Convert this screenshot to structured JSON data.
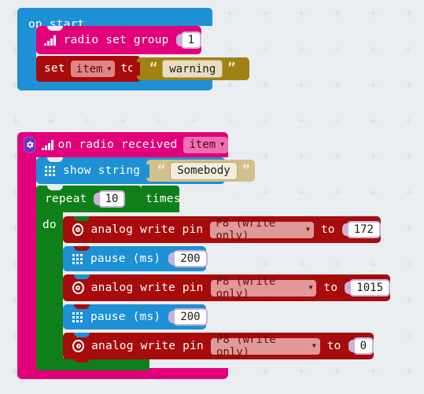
{
  "editor": {
    "name": "makecode-block-editor",
    "background_color": "#eaeef0"
  },
  "colors": {
    "event": "#1e90d6",
    "radio": "#e2007a",
    "variables": "#a80b0b",
    "text": "#a08213",
    "basic": "#1e90d6",
    "loops": "#0f8019",
    "pins": "#a80b0b"
  },
  "scripts": [
    {
      "id": "on-start",
      "header": "on start",
      "children": [
        {
          "id": "radio-set-group",
          "icon": "radio-signal-icon",
          "label": "radio set group",
          "value": "1"
        },
        {
          "id": "set-variable",
          "label_set": "set",
          "variable": "item",
          "label_to": "to",
          "string_value": "warning",
          "quote_open": "“",
          "quote_close": "”"
        }
      ]
    },
    {
      "id": "on-radio-received",
      "gear_icon": "gear-icon",
      "radio_icon": "radio-signal-icon",
      "header": "on radio received",
      "parameter": "item",
      "children": [
        {
          "id": "show-string",
          "icon": "led-grid-icon",
          "label": "show string",
          "string_value": "Somebody",
          "quote_open": "“",
          "quote_close": "”"
        },
        {
          "id": "repeat-loop",
          "label_repeat": "repeat",
          "count": "10",
          "label_times": "times",
          "label_do": "do",
          "children": [
            {
              "id": "analog-write-1",
              "icon": "pin-target-icon",
              "label": "analog write pin",
              "pin": "P8 (write only)",
              "label_to": "to",
              "value": "172"
            },
            {
              "id": "pause-1",
              "icon": "led-grid-icon",
              "label": "pause (ms)",
              "value": "200"
            },
            {
              "id": "analog-write-2",
              "icon": "pin-target-icon",
              "label": "analog write pin",
              "pin": "P8 (write only)",
              "label_to": "to",
              "value": "1015"
            },
            {
              "id": "pause-2",
              "icon": "led-grid-icon",
              "label": "pause (ms)",
              "value": "200"
            },
            {
              "id": "analog-write-3",
              "icon": "pin-target-icon",
              "label": "analog write pin",
              "pin": "P8 (write only)",
              "label_to": "to",
              "value": "0"
            }
          ]
        }
      ]
    }
  ],
  "dropdown_arrow": "▼"
}
